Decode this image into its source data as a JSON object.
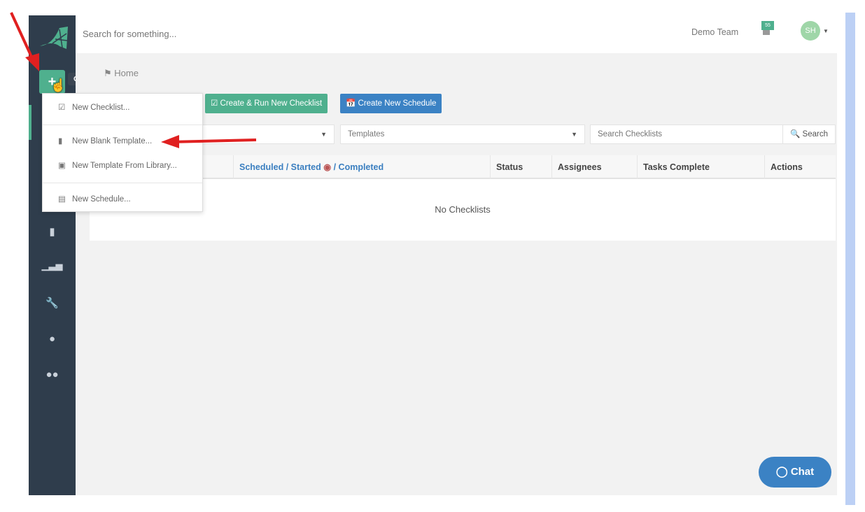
{
  "header": {
    "search_placeholder": "Search for something...",
    "team": "Demo Team",
    "notification_badge": "55",
    "avatar": "SH"
  },
  "sidebar": {
    "create_tooltip": "Create...",
    "icons": [
      "book-icon",
      "bar-chart-icon",
      "wrench-icon",
      "user-icon",
      "users-icon"
    ]
  },
  "breadcrumb": {
    "home": "Home"
  },
  "create_menu": {
    "items": [
      {
        "label": "New Checklist...",
        "icon": "checkbox-icon"
      },
      {
        "label": "New Blank Template...",
        "icon": "file-icon"
      },
      {
        "label": "New Template From Library...",
        "icon": "library-icon"
      },
      {
        "label": "New Schedule...",
        "icon": "calendar-icon"
      }
    ]
  },
  "toolbar": {
    "create_run": "Create & Run New Checklist",
    "create_schedule": "Create New Schedule"
  },
  "filters": {
    "first_select": "",
    "templates_select": "Templates",
    "search_placeholder": "Search Checklists",
    "search_button": "Search"
  },
  "table": {
    "headers": {
      "scheduled": "Scheduled",
      "started": "Started",
      "completed": "Completed",
      "status": "Status",
      "assignees": "Assignees",
      "tasks": "Tasks Complete",
      "actions": "Actions"
    },
    "empty": "No Checklists"
  },
  "chat": {
    "label": "Chat"
  },
  "colors": {
    "sidebar": "#2f3d4c",
    "green": "#4fb08e",
    "blue": "#3b82c4",
    "annotation": "#e02020"
  }
}
